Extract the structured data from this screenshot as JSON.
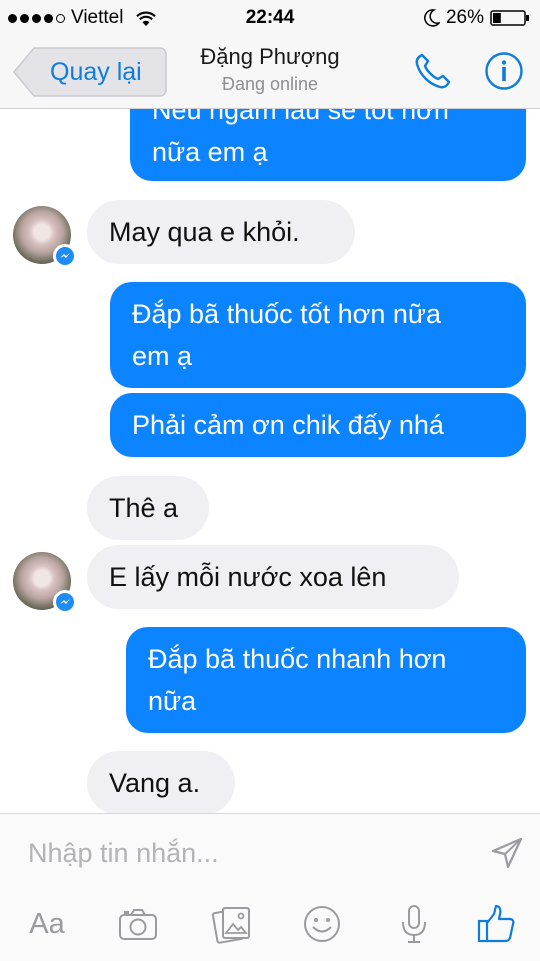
{
  "status_bar": {
    "carrier": "Viettel",
    "time": "22:44",
    "battery": "26%",
    "battery_level": 0.26,
    "signal_bars_filled": 4,
    "signal_bars_total": 5
  },
  "nav": {
    "back_label": "Quay lại",
    "contact_name": "Đặng Phượng",
    "contact_status": "Đang online",
    "accent_color": "#0e7ddc"
  },
  "messages": [
    {
      "side": "out",
      "lines": [
        "Nếu ngâm lâu sẽ tốt hơn",
        "nữa em ạ"
      ]
    },
    {
      "side": "in",
      "lines": [
        "May qua e khỏi."
      ],
      "avatar": true
    },
    {
      "side": "out",
      "lines": [
        "Đắp bã thuốc tốt hơn nữa",
        "em ạ"
      ]
    },
    {
      "side": "out",
      "lines": [
        "Phải cảm ơn chik đấy nhá"
      ]
    },
    {
      "side": "in",
      "lines": [
        "Thê a"
      ]
    },
    {
      "side": "in",
      "lines": [
        "E lấy mỗi nước xoa lên"
      ],
      "avatar": true
    },
    {
      "side": "out",
      "lines": [
        "Đắp bã thuốc nhanh hơn",
        "nữa"
      ]
    },
    {
      "side": "in",
      "lines": [
        "Vang a."
      ]
    }
  ],
  "colors": {
    "outgoing_bubble": "#0d84ff",
    "incoming_bubble": "#f0eff4",
    "like_icon": "#0e7ddc"
  },
  "composer": {
    "placeholder": "Nhập tin nhắn...",
    "aa_label": "Aa",
    "icons": [
      "aa-text-icon",
      "camera-icon",
      "photo-gallery-icon",
      "emoji-icon",
      "microphone-icon",
      "like-thumb-icon"
    ]
  }
}
